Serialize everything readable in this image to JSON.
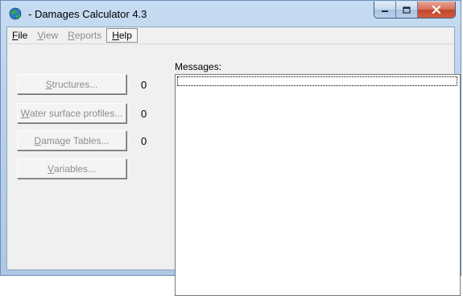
{
  "window": {
    "title": " - Damages Calculator 4.3",
    "icon": "globe-app-icon"
  },
  "caption_buttons": {
    "minimize": "minimize-icon",
    "maximize": "maximize-icon",
    "close": "close-icon"
  },
  "menu": {
    "items": [
      {
        "label": "File",
        "mnemonic": "F",
        "rest": "ile",
        "enabled": true
      },
      {
        "label": "View",
        "mnemonic": "V",
        "rest": "iew",
        "enabled": false
      },
      {
        "label": "Reports",
        "mnemonic": "R",
        "rest": "eports",
        "enabled": false
      },
      {
        "label": "Help",
        "mnemonic": "H",
        "rest": "elp",
        "enabled": true,
        "highlighted": true
      }
    ]
  },
  "buttons": [
    {
      "label": "Structures...",
      "mnemonic": "S",
      "rest": "tructures...",
      "count": "0",
      "enabled": false
    },
    {
      "label": "Water surface profiles...",
      "mnemonic": "W",
      "rest": "ater surface profiles...",
      "count": "0",
      "enabled": false
    },
    {
      "label": "Damage Tables...",
      "mnemonic": "D",
      "rest": "amage Tables...",
      "count": "0",
      "enabled": false
    },
    {
      "label": "Variables...",
      "mnemonic": "V",
      "rest": "ariables...",
      "count": null,
      "enabled": false
    }
  ],
  "messages": {
    "label": "Messages:",
    "content": ""
  },
  "colors": {
    "titlebar": "#b9d1ea",
    "client": "#f0f0f0",
    "disabled_text": "#8d8d8d",
    "close_button": "#c2452c"
  }
}
